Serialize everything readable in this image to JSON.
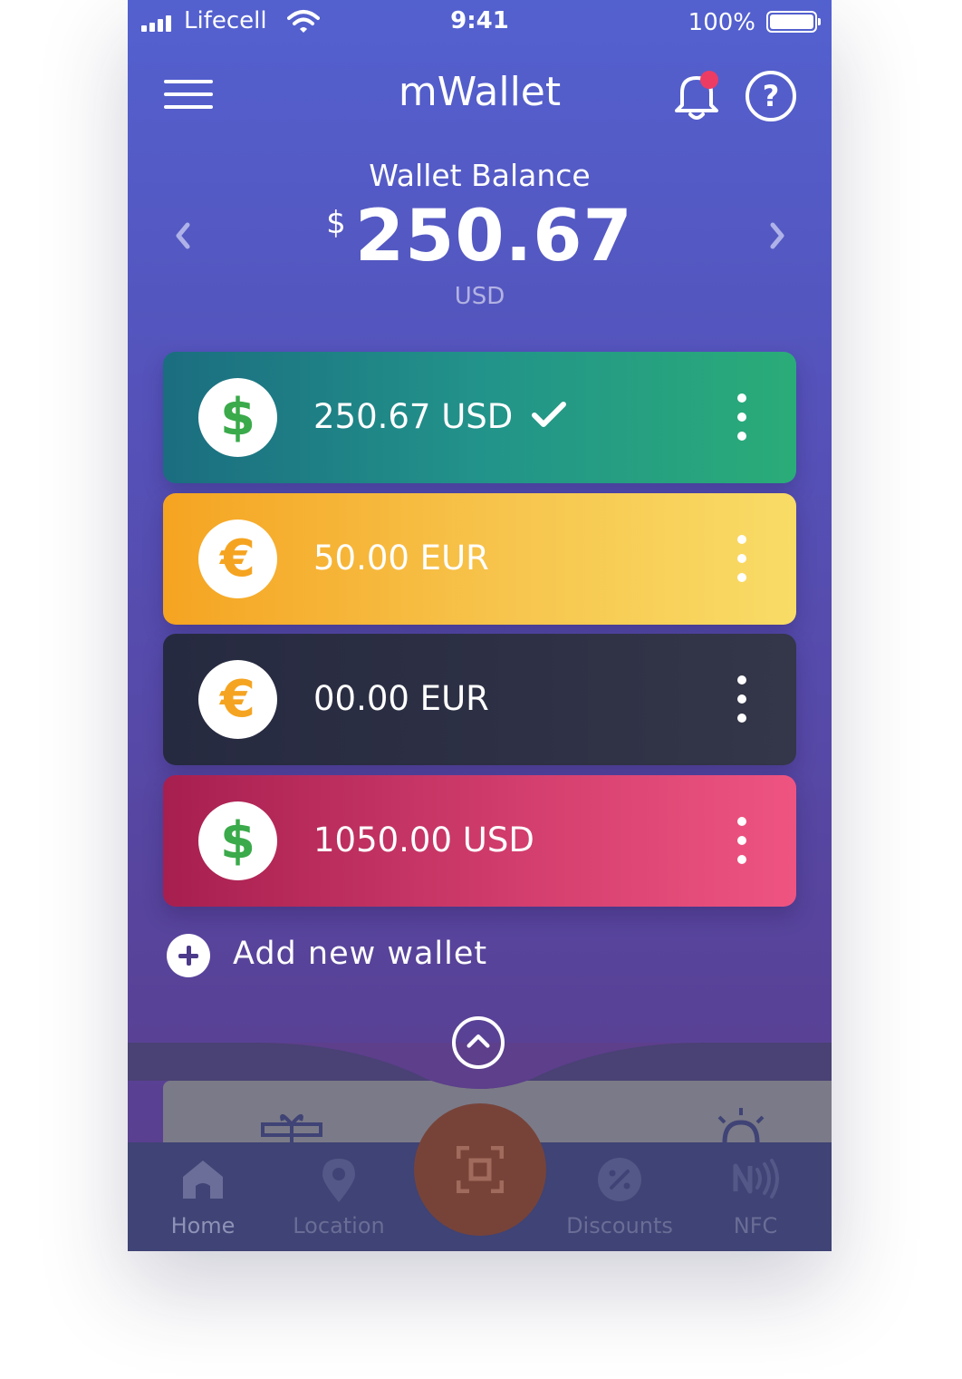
{
  "status_bar": {
    "carrier": "Lifecell",
    "time": "9:41",
    "battery_percent": "100%"
  },
  "header": {
    "title": "mWallet",
    "menu_icon": "hamburger-icon",
    "notification_icon": "bell-icon",
    "help_icon": "help-icon",
    "help_glyph": "?"
  },
  "balance": {
    "label": "Wallet Balance",
    "currency_sign": "$",
    "amount": "250.67",
    "currency_code": "USD"
  },
  "wallets": [
    {
      "symbol": "$",
      "amount": "250.67 USD",
      "selected": true,
      "coin_color": "#3aaa4a"
    },
    {
      "symbol": "€",
      "amount": "50.00 EUR",
      "selected": false,
      "coin_color": "#f5a421"
    },
    {
      "symbol": "€",
      "amount": "00.00 EUR",
      "selected": false,
      "coin_color": "#f5a421"
    },
    {
      "symbol": "$",
      "amount": "1050.00 USD",
      "selected": false,
      "coin_color": "#3aaa4a"
    }
  ],
  "add_wallet": {
    "label": "Add new wallet"
  },
  "tabbar": {
    "items": [
      {
        "label": "Home",
        "icon": "home-icon",
        "active": true
      },
      {
        "label": "Location",
        "icon": "location-pin-icon",
        "active": false
      },
      {
        "label": "",
        "icon": "scan-icon",
        "active": false
      },
      {
        "label": "Discounts",
        "icon": "discount-icon",
        "active": false
      },
      {
        "label": "NFC",
        "icon": "nfc-icon",
        "active": false
      }
    ]
  },
  "colors": {
    "accent_notification": "#ec3c64",
    "scan_button": "#774339",
    "tabbar": "#3f4375"
  }
}
